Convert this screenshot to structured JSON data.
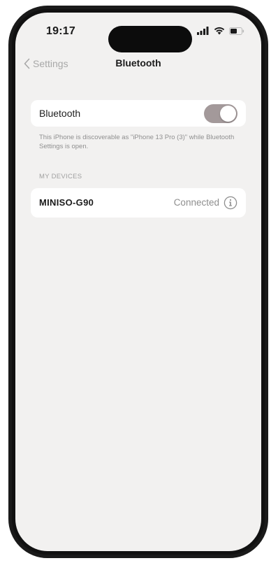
{
  "status_bar": {
    "time": "19:17",
    "icons": [
      "signal-icon",
      "wifi-icon",
      "battery-icon"
    ]
  },
  "nav": {
    "back_label": "Settings",
    "title": "Bluetooth"
  },
  "bluetooth": {
    "label": "Bluetooth",
    "toggle_on": true,
    "toggle_color": "#a3999a"
  },
  "footnote": "This iPhone is discoverable as \"iPhone 13 Pro (3)\" while Bluetooth Settings is open.",
  "my_devices": {
    "header": "MY DEVICES",
    "items": [
      {
        "name": "MINISO-G90",
        "status": "Connected",
        "icon": "info-icon"
      }
    ]
  },
  "colors": {
    "background": "#f2f1f0",
    "card": "#ffffff",
    "secondary_text": "#8e8e8e"
  }
}
